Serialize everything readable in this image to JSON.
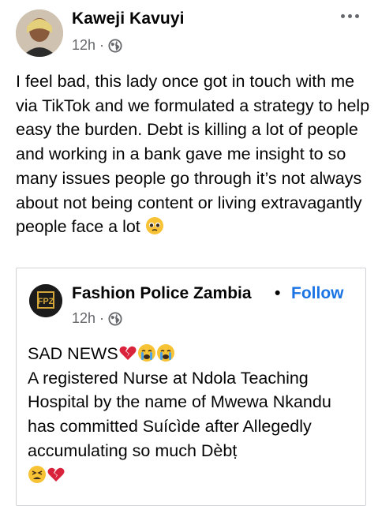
{
  "post": {
    "author": "Kaweji Kavuyi",
    "time": "12h",
    "separator": "·",
    "text": "I feel bad, this lady once got in touch with me via TikTok and we formulated a strategy to help easy the burden. Debt is killing a lot of people and working in a bank gave me insight to so many issues people go through it’s not always about not being content or living extravagantly people face a lot"
  },
  "shared_post": {
    "page_name": "Fashion Police Zambia",
    "separator": "•",
    "follow_label": "Follow",
    "time": "12h",
    "time_separator": "·",
    "line1": "SAD NEWS",
    "line2": "A registered Nurse at Ndola Teaching Hospital by the name of Mwewa Nkandu has committed Suícìde after Allegedly accumulating so much Dèbṭ"
  },
  "icons": {
    "privacy": "globe-icon",
    "more": "more-options-icon"
  },
  "colors": {
    "link": "#1b74e4",
    "meta": "#65676b",
    "text": "#050505"
  }
}
